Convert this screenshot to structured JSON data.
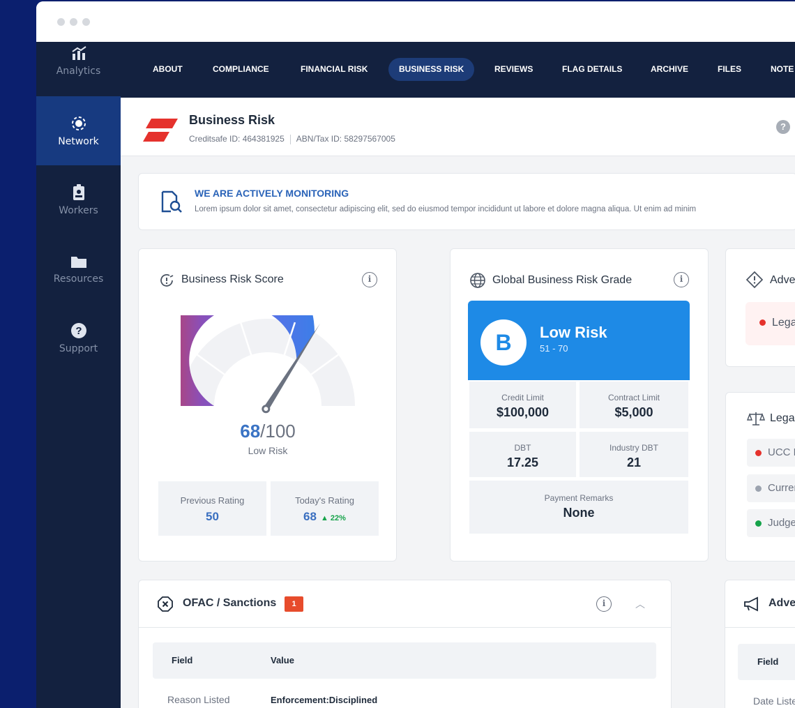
{
  "sidebar": {
    "items": [
      {
        "label": "Analytics",
        "icon": "analytics-icon"
      },
      {
        "label": "Network",
        "icon": "network-icon",
        "active": true
      },
      {
        "label": "Workers",
        "icon": "id-badge-icon"
      },
      {
        "label": "Resources",
        "icon": "folder-icon"
      },
      {
        "label": "Support",
        "icon": "question-icon"
      }
    ]
  },
  "nav": {
    "tabs": [
      "ABOUT",
      "COMPLIANCE",
      "FINANCIAL RISK",
      "BUSINESS RISK",
      "REVIEWS",
      "FLAG DETAILS",
      "ARCHIVE",
      "FILES",
      "NOTE"
    ],
    "active": "BUSINESS RISK"
  },
  "header": {
    "title": "Business Risk",
    "creditsafe_id": "Creditsafe ID: 464381925",
    "abn_tax_id": "ABN/Tax ID: 58297567005",
    "help": "?"
  },
  "monitoring": {
    "title": "WE ARE ACTIVELY MONITORING",
    "text": "Lorem ipsum dolor sit amet, consectetur adipiscing elit, sed do eiusmod tempor incididunt ut labore et dolore magna aliqua. Ut enim ad minim"
  },
  "risk_score": {
    "title": "Business Risk Score",
    "score": "68",
    "max": "/100",
    "score_value": 68,
    "score_max": 100,
    "label": "Low Risk",
    "previous_label": "Previous Rating",
    "previous_value": "50",
    "today_label": "Today's Rating",
    "today_value": "68",
    "today_change": "▲ 22%"
  },
  "grade": {
    "title": "Global Business Risk Grade",
    "letter": "B",
    "label": "Low Risk",
    "range": "51 - 70",
    "credit_limit_label": "Credit Limit",
    "credit_limit": "$100,000",
    "contract_limit_label": "Contract Limit",
    "contract_limit": "$5,000",
    "dbt_label": "DBT",
    "dbt": "17.25",
    "industry_dbt_label": "Industry DBT",
    "industry_dbt": "21",
    "payment_remarks_label": "Payment Remarks",
    "payment_remarks": "None"
  },
  "adverse_business": {
    "title": "Adverse Bu",
    "item": "Legal / Fin"
  },
  "legal_financial": {
    "title": "Legal/Finar",
    "items": [
      "UCC Filings",
      "Currency",
      "Judgement"
    ]
  },
  "ofac": {
    "title": "OFAC / Sanctions",
    "badge": "1",
    "field_header": "Field",
    "value_header": "Value",
    "row_field": "Reason Listed",
    "row_value": "Enforcement:Disciplined"
  },
  "adverse_media": {
    "title": "Adverse Me",
    "field_header": "Field",
    "row_field": "Date Listed"
  },
  "colors": {
    "sidebar_bg": "#13213f",
    "active_tab": "#1d3c78",
    "accent_blue": "#1e8ae6",
    "badge_red": "#e74c2c",
    "positive_green": "#16a34a"
  }
}
